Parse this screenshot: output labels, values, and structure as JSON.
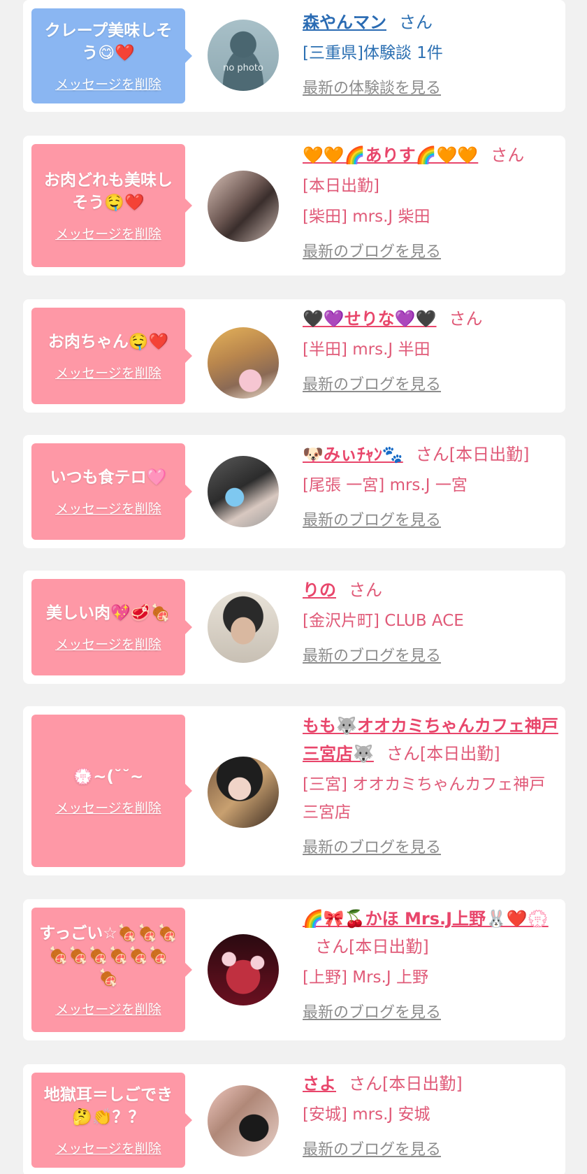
{
  "delete_label": "メッセージを削除",
  "san": "さん",
  "cards": [
    {
      "message": "クレープ美味しそう😋❤️",
      "bubble_color": "#8ab6f2",
      "avatar_text": "no photo",
      "name": "森やんマン",
      "name_suffix": "さん",
      "lines": [
        "[三重県]体験談 1件"
      ],
      "link": "最新の体験談を見る"
    },
    {
      "message": "お肉どれも美味しそう🤤❤️",
      "bubble_color": "#fe98a6",
      "name": "🧡🧡🌈ありす🌈🧡🧡",
      "name_suffix": "さん",
      "lines": [
        "[本日出勤]",
        "[柴田] mrs.J 柴田"
      ],
      "link": "最新のブログを見る"
    },
    {
      "message": "お肉ちゃん🤤❤️",
      "bubble_color": "#fe98a6",
      "name": "🖤💜せりな💜🖤",
      "name_suffix": "さん",
      "lines": [
        "[半田] mrs.J 半田"
      ],
      "link": "最新のブログを見る"
    },
    {
      "message": "いつも食テロ🩷",
      "bubble_color": "#fe98a6",
      "name": "🐶みぃﾁｬﾝ🐾",
      "name_suffix": "さん[本日出勤]",
      "lines": [
        "[尾張 一宮] mrs.J 一宮"
      ],
      "link": "最新のブログを見る"
    },
    {
      "message": "美しい肉💖🥩🍖",
      "bubble_color": "#fe98a6",
      "name": "りの",
      "name_suffix": "さん",
      "lines": [
        "[金沢片町] CLUB ACE"
      ],
      "link": "最新のブログを見る"
    },
    {
      "message": "💮~(˘˘~",
      "bubble_color": "#fe98a6",
      "name": "もも🐺オオカミちゃんカフェ神戸三宮店🐺",
      "name_suffix": "さん[本日出勤]",
      "lines": [
        "[三宮] オオカミちゃんカフェ神戸三宮店"
      ],
      "link": "最新のブログを見る"
    },
    {
      "message": "すっごい☆🍖🍖🍖🍖🍖🍖🍖🍖🍖🍖",
      "bubble_color": "#fe98a6",
      "name": "🌈🎀🍒かほ Mrs.J上野🐰❤️💮",
      "name_suffix": "さん[本日出勤]",
      "lines": [
        "[上野] Mrs.J 上野"
      ],
      "link": "最新のブログを見る"
    },
    {
      "message": "地獄耳＝しごでき🤔👏？？",
      "bubble_color": "#fe98a6",
      "name": "さよ",
      "name_suffix": "さん[本日出勤]",
      "lines": [
        "[安城] mrs.J 安城"
      ],
      "link": "最新のブログを見る"
    }
  ]
}
